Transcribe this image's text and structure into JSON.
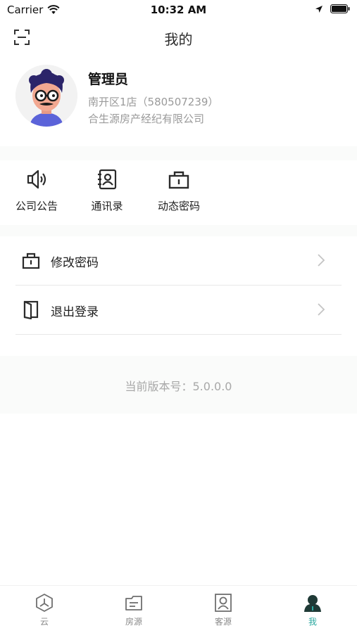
{
  "status_bar": {
    "carrier": "Carrier",
    "time": "10:32 AM"
  },
  "nav": {
    "title": "我的"
  },
  "profile": {
    "name": "管理员",
    "store": "南开区1店（580507239）",
    "company": "合生源房产经纪有限公司"
  },
  "quick_actions": [
    {
      "label": "公司公告",
      "icon": "speaker-icon"
    },
    {
      "label": "通讯录",
      "icon": "contact-book-icon"
    },
    {
      "label": "动态密码",
      "icon": "lock-icon"
    }
  ],
  "menu": [
    {
      "label": "修改密码",
      "icon": "lock-icon"
    },
    {
      "label": "退出登录",
      "icon": "door-exit-icon"
    }
  ],
  "version": {
    "text": "当前版本号：5.0.0.0"
  },
  "tabs": [
    {
      "label": "云",
      "icon": "cloud-hex-icon",
      "active": false
    },
    {
      "label": "房源",
      "icon": "house-listing-icon",
      "active": false
    },
    {
      "label": "客源",
      "icon": "customer-icon",
      "active": false
    },
    {
      "label": "我",
      "icon": "person-icon",
      "active": true
    }
  ],
  "colors": {
    "accent": "#2aa89f",
    "band": "#fafbfa",
    "muted_text": "#9a9a9a"
  }
}
